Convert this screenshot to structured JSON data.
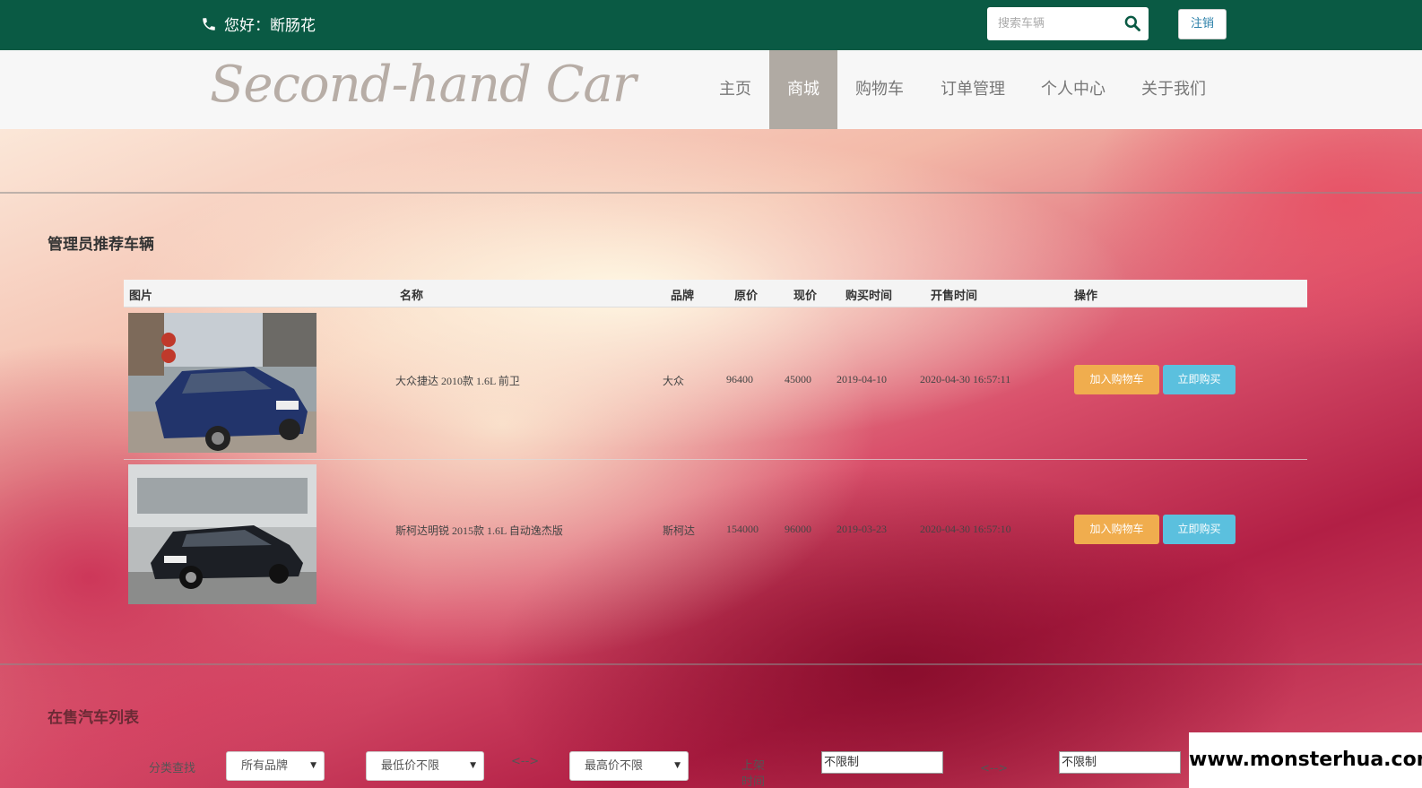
{
  "topbar": {
    "greeting": "您好：断肠花",
    "search_placeholder": "搜索车辆",
    "logout_label": "注销"
  },
  "nav": {
    "logo": "Second-hand Car",
    "items": [
      {
        "label": "主页",
        "active": false
      },
      {
        "label": "商城",
        "active": true
      },
      {
        "label": "购物车",
        "active": false
      },
      {
        "label": "订单管理",
        "active": false
      },
      {
        "label": "个人中心",
        "active": false
      },
      {
        "label": "关于我们",
        "active": false
      }
    ]
  },
  "recommended": {
    "title": "管理员推荐车辆",
    "columns": [
      "图片",
      "名称",
      "品牌",
      "原价",
      "现价",
      "购买时间",
      "开售时间",
      "操作"
    ],
    "rows": [
      {
        "name": "大众捷达 2010款 1.6L 前卫",
        "brand": "大众",
        "original_price": "96400",
        "current_price": "45000",
        "purchase_date": "2019-04-10",
        "sale_time": "2020-04-30 16:57:11",
        "add_cart_label": "加入购物车",
        "buy_now_label": "立即购买"
      },
      {
        "name": "斯柯达明锐 2015款 1.6L 自动逸杰版",
        "brand": "斯柯达",
        "original_price": "154000",
        "current_price": "96000",
        "purchase_date": "2019-03-23",
        "sale_time": "2020-04-30 16:57:10",
        "add_cart_label": "加入购物车",
        "buy_now_label": "立即购买"
      }
    ]
  },
  "on_sale": {
    "title": "在售汽车列表",
    "filter_label": "分类查找",
    "brand_select": "所有品牌",
    "min_price_select": "最低价不限",
    "range_sep": "<-->",
    "max_price_select": "最高价不限",
    "time_label": "上架时间",
    "time_from": "不限制",
    "time_to": "不限制"
  },
  "watermark": "www.monsterhua.com",
  "colors": {
    "topbar": "#0a5a44",
    "nav_active": "#b0aaa3",
    "btn_cart": "#f0ad4e",
    "btn_buy": "#5bc0de"
  }
}
